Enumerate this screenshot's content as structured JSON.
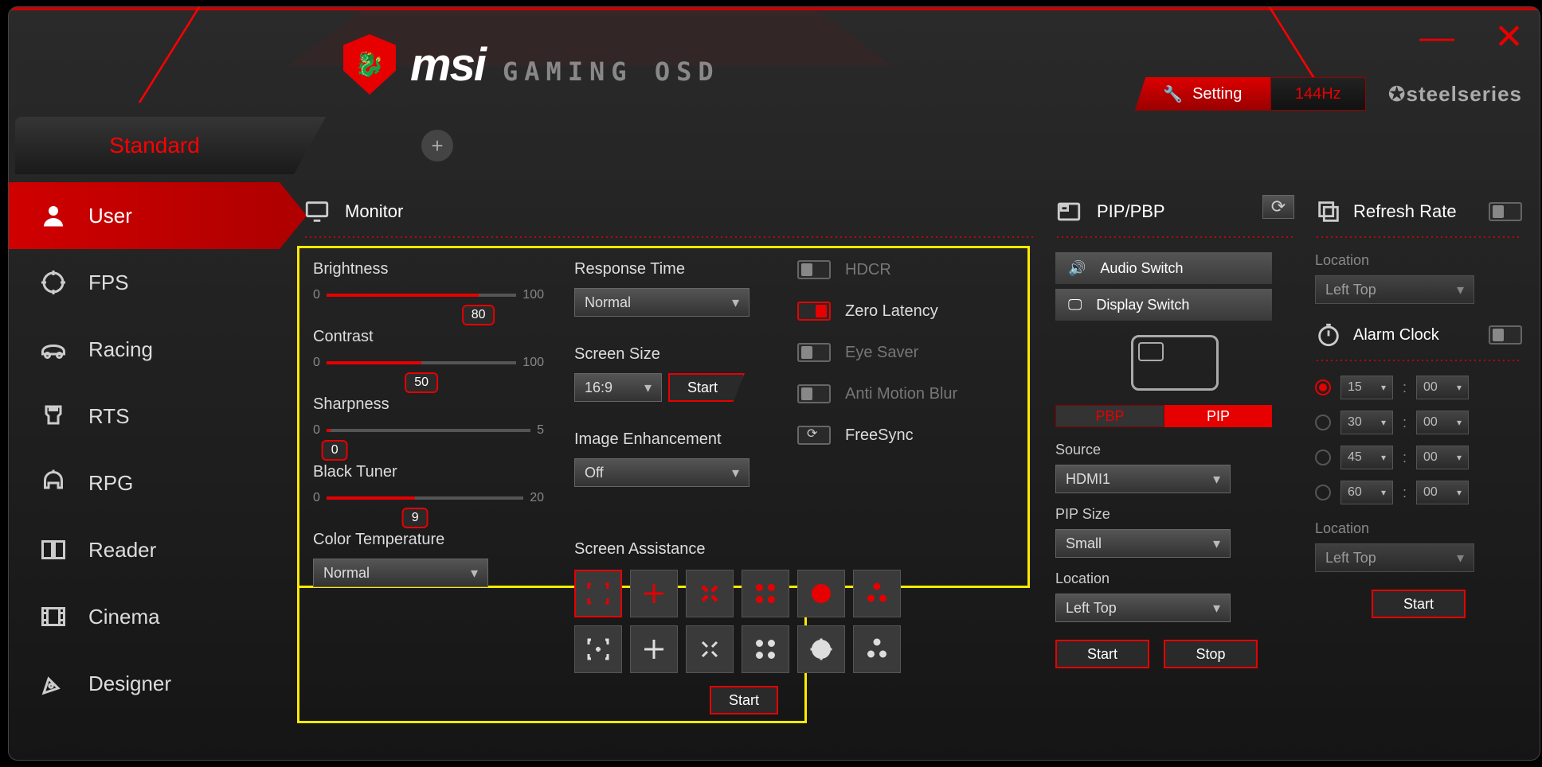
{
  "header": {
    "brand_main": "msi",
    "brand_sub": "GAMING OSD",
    "setting_label": "Setting",
    "refresh_hz": "144Hz",
    "partner": "steelseries"
  },
  "tabs": {
    "active": "Standard"
  },
  "sidebar": {
    "items": [
      {
        "key": "user",
        "label": "User",
        "active": true
      },
      {
        "key": "fps",
        "label": "FPS"
      },
      {
        "key": "racing",
        "label": "Racing"
      },
      {
        "key": "rts",
        "label": "RTS"
      },
      {
        "key": "rpg",
        "label": "RPG"
      },
      {
        "key": "reader",
        "label": "Reader"
      },
      {
        "key": "cinema",
        "label": "Cinema"
      },
      {
        "key": "designer",
        "label": "Designer"
      }
    ]
  },
  "monitor": {
    "title": "Monitor",
    "brightness": {
      "label": "Brightness",
      "min": "0",
      "max": "100",
      "value": "80",
      "pct": 80
    },
    "contrast": {
      "label": "Contrast",
      "min": "0",
      "max": "100",
      "value": "50",
      "pct": 50
    },
    "sharpness": {
      "label": "Sharpness",
      "min": "0",
      "max": "5",
      "value": "0",
      "pct": 0
    },
    "black_tuner": {
      "label": "Black Tuner",
      "min": "0",
      "max": "20",
      "value": "9",
      "pct": 45
    },
    "color_temp": {
      "label": "Color Temperature",
      "value": "Normal"
    },
    "response_time": {
      "label": "Response Time",
      "value": "Normal"
    },
    "screen_size": {
      "label": "Screen Size",
      "value": "16:9",
      "start": "Start"
    },
    "image_enh": {
      "label": "Image Enhancement",
      "value": "Off"
    },
    "toggles": {
      "hdcr": {
        "label": "HDCR",
        "on": false,
        "dim": true
      },
      "zero_latency": {
        "label": "Zero Latency",
        "on": true
      },
      "eye_saver": {
        "label": "Eye Saver",
        "on": false,
        "dim": true
      },
      "anti_motion": {
        "label": "Anti Motion Blur",
        "on": false,
        "dim": true
      },
      "freesync": {
        "label": "FreeSync",
        "rot": true
      }
    },
    "screen_assist": {
      "label": "Screen Assistance",
      "start": "Start"
    }
  },
  "pip": {
    "title": "PIP/PBP",
    "audio_switch": "Audio Switch",
    "display_switch": "Display Switch",
    "mode_pbp": "PBP",
    "mode_pip": "PIP",
    "source": {
      "label": "Source",
      "value": "HDMI1"
    },
    "size": {
      "label": "PIP Size",
      "value": "Small"
    },
    "location": {
      "label": "Location",
      "value": "Left Top"
    },
    "start": "Start",
    "stop": "Stop"
  },
  "refresh": {
    "title": "Refresh Rate",
    "location": {
      "label": "Location",
      "value": "Left Top"
    },
    "alarm_title": "Alarm Clock",
    "alarm_rows": [
      {
        "m": "15",
        "s": "00",
        "sel": true
      },
      {
        "m": "30",
        "s": "00"
      },
      {
        "m": "45",
        "s": "00"
      },
      {
        "m": "60",
        "s": "00"
      }
    ],
    "location2": {
      "label": "Location",
      "value": "Left Top"
    },
    "start": "Start"
  }
}
